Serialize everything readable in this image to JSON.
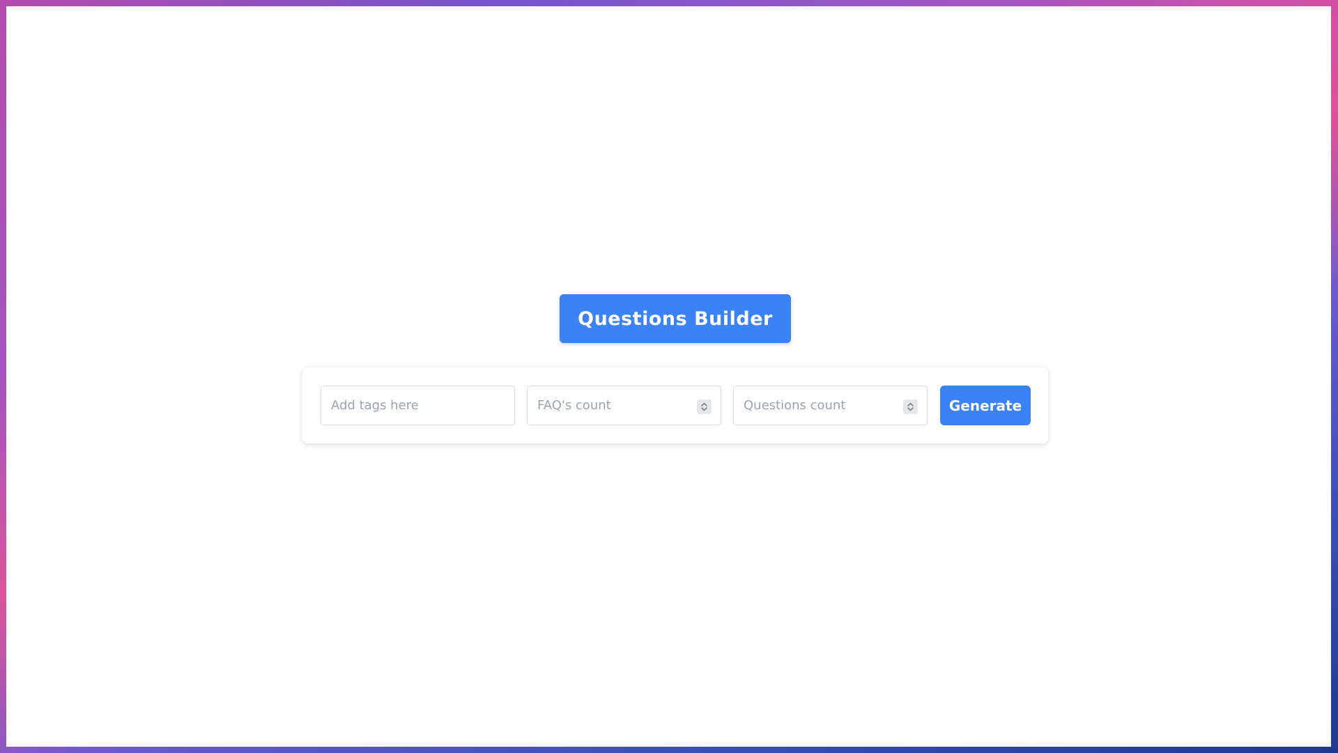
{
  "header": {
    "title": "Questions Builder"
  },
  "form": {
    "tags_input": {
      "placeholder": "Add tags here",
      "value": ""
    },
    "faq_count_input": {
      "placeholder": "FAQ's count",
      "value": ""
    },
    "questions_count_input": {
      "placeholder": "Questions count",
      "value": ""
    },
    "generate_label": "Generate"
  },
  "colors": {
    "accent": "#3b82f6",
    "placeholder_text": "#9ca3af",
    "field_border": "#d9dbe0"
  },
  "icons": {
    "number_stepper": "up-down-chevron-icon"
  }
}
